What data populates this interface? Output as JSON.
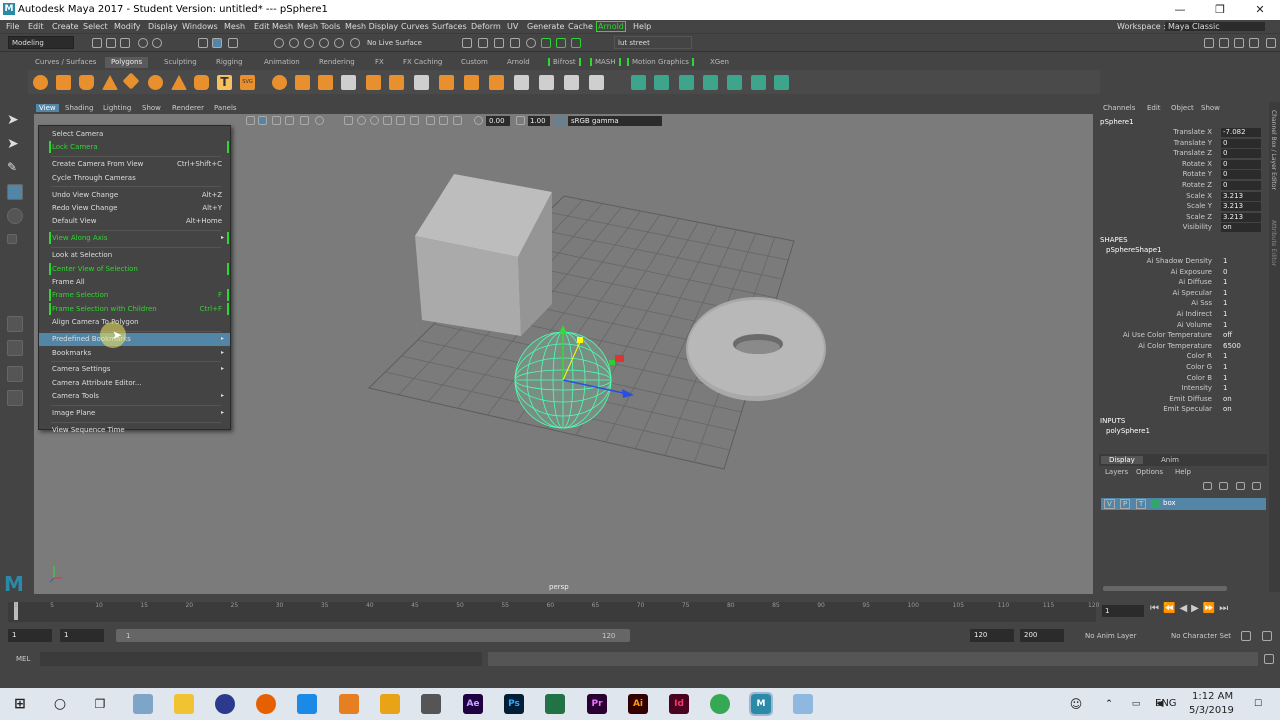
{
  "window": {
    "title": "Autodesk Maya 2017 - Student Version: untitled*   ---   pSphere1",
    "icon": "M"
  },
  "menubar": [
    "File",
    "Edit",
    "Create",
    "Select",
    "Modify",
    "Display",
    "Windows",
    "Mesh",
    "Edit Mesh",
    "Mesh Tools",
    "Mesh Display",
    "Curves",
    "Surfaces",
    "Deform",
    "UV",
    "Generate",
    "Cache",
    "Arnold",
    "Help"
  ],
  "workspace": {
    "label": "Workspace :",
    "value": "Maya Classic"
  },
  "statusline": {
    "mode": "Modeling",
    "live_surface": "No Live Surface",
    "render_setup": "lut street"
  },
  "shelf_tabs": [
    "Curves / Surfaces",
    "Polygons",
    "Sculpting",
    "Rigging",
    "Animation",
    "Rendering",
    "FX",
    "FX Caching",
    "Custom",
    "Arnold",
    "Bifrost",
    "MASH",
    "Motion Graphics",
    "XGen"
  ],
  "panel_menu": [
    "View",
    "Shading",
    "Lighting",
    "Show",
    "Renderer",
    "Panels"
  ],
  "panel_toolbar": {
    "exposure": "0.00",
    "gamma": "1.00",
    "colorspace": "sRGB gamma"
  },
  "view_menu": [
    {
      "label": "Select Camera",
      "shortcut": ""
    },
    {
      "label": "Lock Camera",
      "shortcut": "",
      "green": true
    },
    {
      "label": "Create Camera From View",
      "shortcut": "Ctrl+Shift+C"
    },
    {
      "label": "Cycle Through Cameras",
      "shortcut": ""
    },
    {
      "label": "Undo View Change",
      "shortcut": "Alt+Z"
    },
    {
      "label": "Redo View Change",
      "shortcut": "Alt+Y"
    },
    {
      "label": "Default View",
      "shortcut": "Alt+Home"
    },
    {
      "label": "View Along Axis",
      "shortcut": "",
      "green": true,
      "sub": true
    },
    {
      "label": "Look at Selection",
      "shortcut": ""
    },
    {
      "label": "Center View of Selection",
      "shortcut": "",
      "green": true
    },
    {
      "label": "Frame All",
      "shortcut": ""
    },
    {
      "label": "Frame Selection",
      "shortcut": "F",
      "green": true
    },
    {
      "label": "Frame Selection with Children",
      "shortcut": "Ctrl+F",
      "green": true
    },
    {
      "label": "Align Camera To Polygon",
      "shortcut": ""
    },
    {
      "label": "Predefined Bookmarks",
      "shortcut": "",
      "sub": true,
      "highlight": true
    },
    {
      "label": "Bookmarks",
      "shortcut": "",
      "sub": true
    },
    {
      "label": "Camera Settings",
      "shortcut": "",
      "sub": true
    },
    {
      "label": "Camera Attribute Editor...",
      "shortcut": ""
    },
    {
      "label": "Camera Tools",
      "shortcut": "",
      "sub": true
    },
    {
      "label": "Image Plane",
      "shortcut": "",
      "sub": true
    },
    {
      "label": "View Sequence Time",
      "shortcut": ""
    }
  ],
  "viewport": {
    "camera": "persp"
  },
  "channel_box": {
    "menu": [
      "Channels",
      "Edit",
      "Object",
      "Show"
    ],
    "object": "pSphere1",
    "channels": [
      {
        "name": "Translate X",
        "value": "-7.082"
      },
      {
        "name": "Translate Y",
        "value": "0"
      },
      {
        "name": "Translate Z",
        "value": "0"
      },
      {
        "name": "Rotate X",
        "value": "0"
      },
      {
        "name": "Rotate Y",
        "value": "0"
      },
      {
        "name": "Rotate Z",
        "value": "0"
      },
      {
        "name": "Scale X",
        "value": "3.213"
      },
      {
        "name": "Scale Y",
        "value": "3.213"
      },
      {
        "name": "Scale Z",
        "value": "3.213"
      },
      {
        "name": "Visibility",
        "value": "on"
      }
    ],
    "shapes_header": "SHAPES",
    "shape": "pSphereShape1",
    "shape_attrs": [
      {
        "name": "Ai Shadow Density",
        "value": "1"
      },
      {
        "name": "Ai Exposure",
        "value": "0"
      },
      {
        "name": "Ai Diffuse",
        "value": "1"
      },
      {
        "name": "Ai Specular",
        "value": "1"
      },
      {
        "name": "Ai Sss",
        "value": "1"
      },
      {
        "name": "Ai Indirect",
        "value": "1"
      },
      {
        "name": "Ai Volume",
        "value": "1"
      },
      {
        "name": "Ai Use Color Temperature",
        "value": "off"
      },
      {
        "name": "Ai Color Temperature",
        "value": "6500"
      },
      {
        "name": "Color R",
        "value": "1"
      },
      {
        "name": "Color G",
        "value": "1"
      },
      {
        "name": "Color B",
        "value": "1"
      },
      {
        "name": "Intensity",
        "value": "1"
      },
      {
        "name": "Emit Diffuse",
        "value": "on"
      },
      {
        "name": "Emit Specular",
        "value": "on"
      }
    ],
    "inputs_header": "INPUTS",
    "input": "polySphere1"
  },
  "layers": {
    "tabs": [
      "Display",
      "Anim"
    ],
    "menu": [
      "Layers",
      "Options",
      "Help"
    ],
    "layer_name": "box",
    "flags": [
      "V",
      "P",
      "T"
    ]
  },
  "side_tabs": [
    "Channel Box / Layer Editor",
    "Attribute Editor"
  ],
  "timeline": {
    "ticks": [
      "1",
      "5",
      "10",
      "15",
      "20",
      "25",
      "30",
      "35",
      "40",
      "45",
      "50",
      "55",
      "60",
      "65",
      "70",
      "75",
      "80",
      "85",
      "90",
      "95",
      "100",
      "105",
      "110",
      "115",
      "120"
    ],
    "current": "1"
  },
  "range": {
    "start": "1",
    "inner_start": "1",
    "range_start_label": "1",
    "range_end_label": "120",
    "end": "120",
    "outer_end": "200",
    "anim_layer": "No Anim Layer",
    "char_set": "No Character Set"
  },
  "cmdline": {
    "label": "MEL"
  },
  "taskbar": {
    "lang": "ENG",
    "time": "1:12 AM",
    "date": "5/3/2019"
  }
}
